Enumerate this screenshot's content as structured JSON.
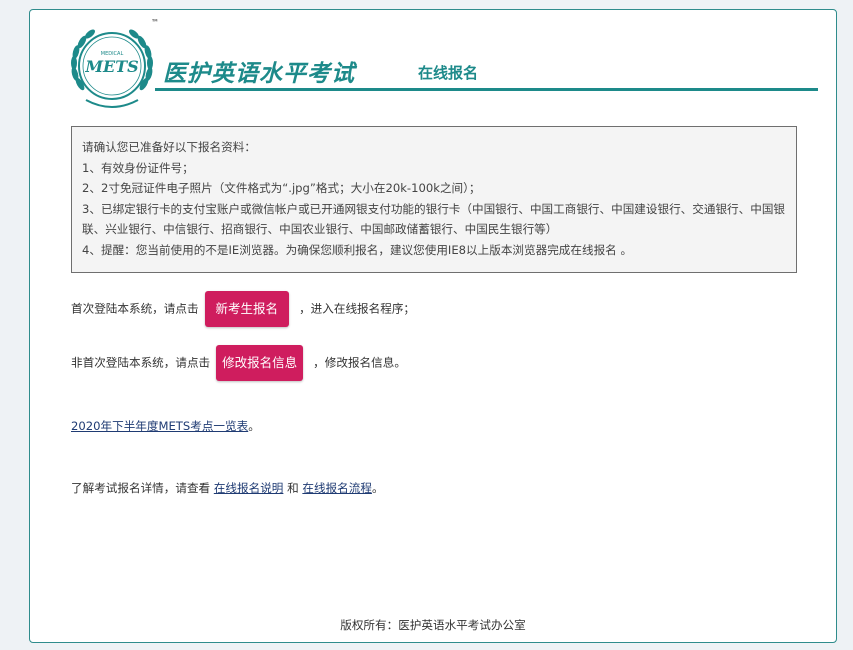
{
  "header": {
    "logo_text": "METS",
    "logo_small_text": "MEDICAL",
    "trademark": "™",
    "title": "医护英语水平考试",
    "subtitle": "在线报名"
  },
  "notice": {
    "lines": [
      "请确认您已准备好以下报名资料：",
      "1、有效身份证件号；",
      "2、2寸免冠证件电子照片（文件格式为“.jpg”格式；大小在20k-100k之间）；",
      "3、已绑定银行卡的支付宝账户或微信帐户或已开通网银支付功能的银行卡（中国银行、中国工商银行、中国建设银行、交通银行、中国银联、兴业银行、中信银行、招商银行、中国农业银行、中国邮政储蓄银行、中国民生银行等）",
      "4、提醒：您当前使用的不是IE浏览器。为确保您顺利报名，建议您使用IE8以上版本浏览器完成在线报名 。"
    ]
  },
  "new_user": {
    "prefix": "首次登陆本系统，请点击",
    "button": "新考生报名",
    "suffix": "，进入在线报名程序；"
  },
  "returning_user": {
    "prefix": "非首次登陆本系统，请点击",
    "button": "修改报名信息",
    "suffix": "，修改报名信息。"
  },
  "sites_link": {
    "text": "2020年下半年度METS考点一览表",
    "suffix": "。"
  },
  "details": {
    "prefix": "了解考试报名详情，请查看 ",
    "link1": "在线报名说明",
    "middle": " 和 ",
    "link2": "在线报名流程",
    "suffix": "。"
  },
  "footer": {
    "copyright": "版权所有：医护英语水平考试办公室"
  },
  "colors": {
    "accent": "#1d8a8a",
    "button": "#cf1d5e",
    "link": "#1f3b73"
  }
}
